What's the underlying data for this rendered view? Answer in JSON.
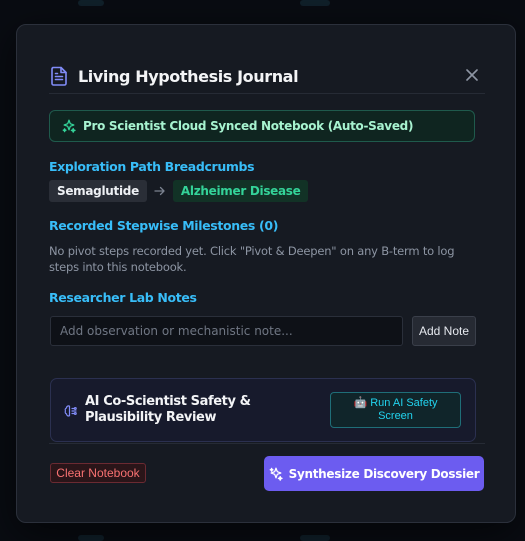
{
  "modal": {
    "title": "Living Hypothesis Journal",
    "sync_banner": "Pro Scientist Cloud Synced Notebook (Auto-Saved)",
    "breadcrumbs": {
      "label": "Exploration Path Breadcrumbs",
      "items": [
        "Semaglutide",
        "Alzheimer Disease"
      ]
    },
    "milestones": {
      "label": "Recorded Stepwise Milestones (0)",
      "empty_text": "No pivot steps recorded yet. Click \"Pivot & Deepen\" on any B-term to log steps into this notebook."
    },
    "notes": {
      "label": "Researcher Lab Notes",
      "input_placeholder": "Add observation or mechanistic note...",
      "input_value": "",
      "add_label": "Add Note"
    },
    "safety": {
      "title": "AI Co-Scientist Safety & Plausibility Review",
      "run_label_line1": "🤖 Run AI Safety",
      "run_label_line2": "Screen"
    },
    "footer": {
      "clear_label": "Clear Notebook",
      "synthesize_label": "Synthesize Discovery Dossier"
    }
  },
  "colors": {
    "accent": "#6c5cf0",
    "section_label": "#38bdf8",
    "success": "#34d399",
    "danger": "#f87171"
  },
  "icons": [
    "document-icon",
    "close-icon",
    "sparkles-icon",
    "arrow-right-icon",
    "brain-circuit-icon"
  ]
}
